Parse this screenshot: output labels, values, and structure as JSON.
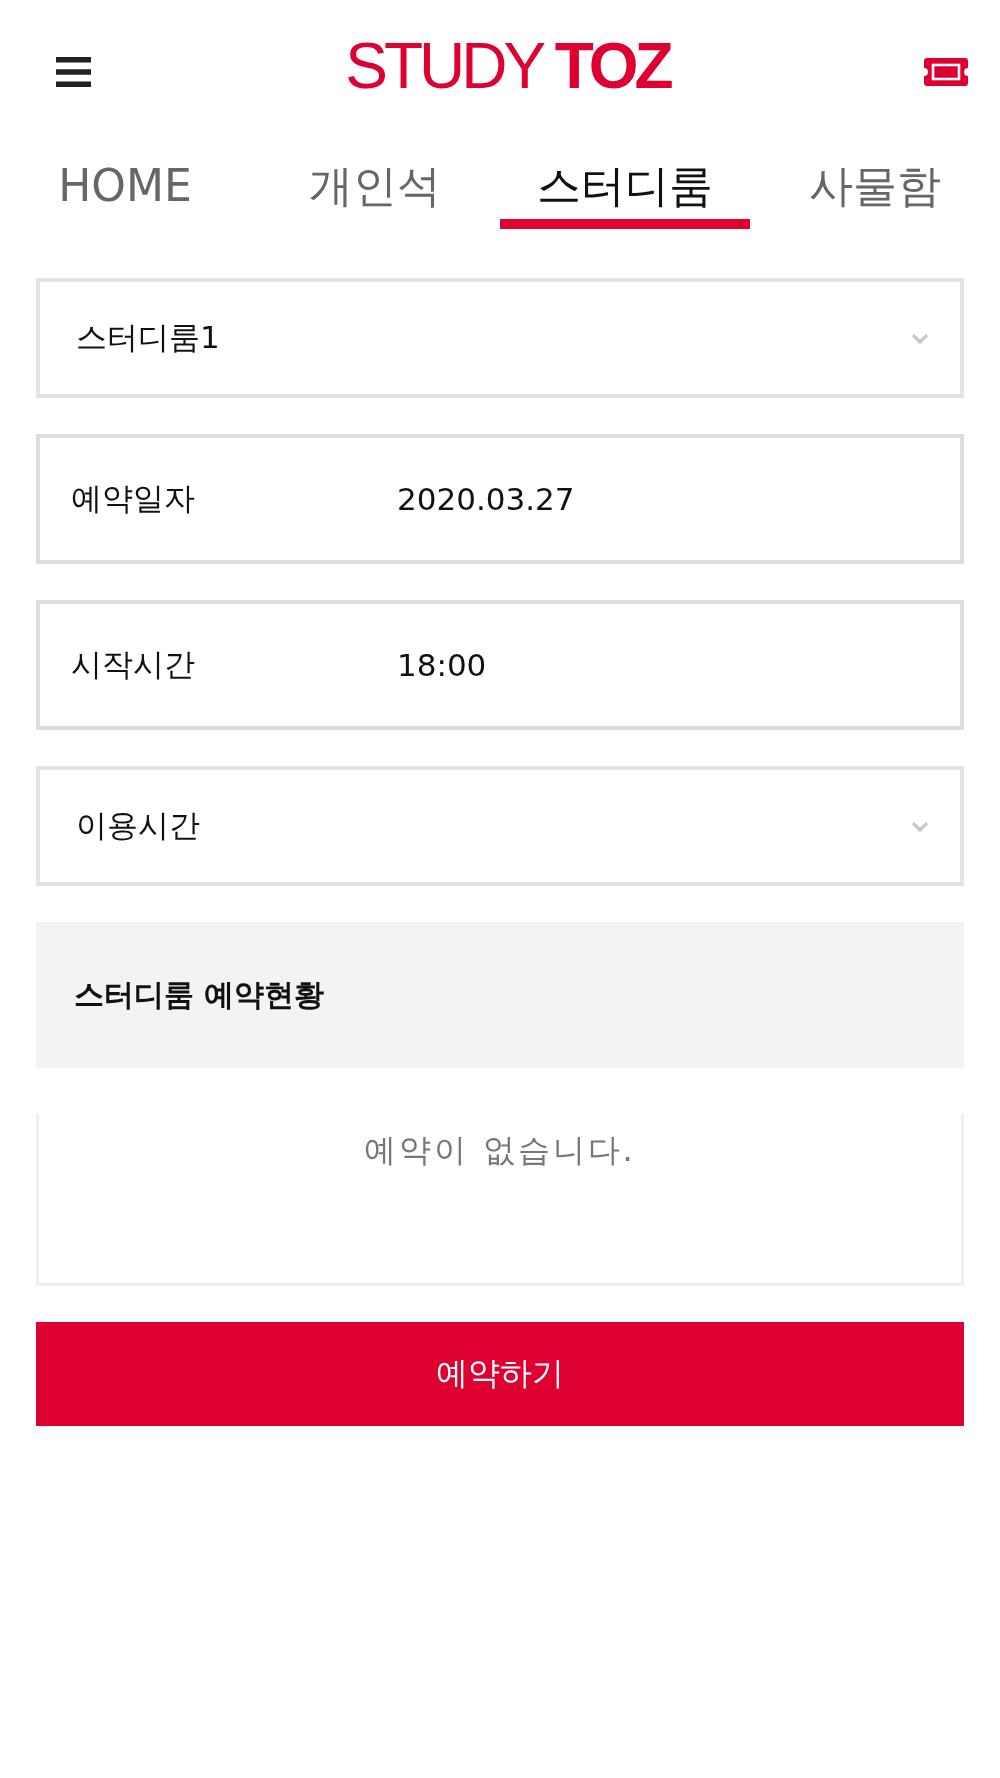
{
  "header": {
    "logo": "STUDY **TOZ**"
  },
  "tabs": [
    {
      "label": "HOME",
      "selected": false
    },
    {
      "label": "개인석",
      "selected": false
    },
    {
      "label": "스터디룸",
      "selected": true
    },
    {
      "label": "사물함",
      "selected": false
    }
  ],
  "fields": [
    {
      "kind": "select",
      "value": "스터디룸1"
    },
    {
      "kind": "text",
      "label": "예약일자",
      "value": "2020.03.27"
    },
    {
      "kind": "text",
      "label": "시작시간",
      "value": "18:00"
    },
    {
      "kind": "select",
      "value": "이용시간"
    }
  ],
  "reservation_status": {
    "title": "스터디룸 예약현황",
    "empty_message": "예약이 없습니다."
  },
  "submit_button": {
    "label": "예약하기"
  }
}
